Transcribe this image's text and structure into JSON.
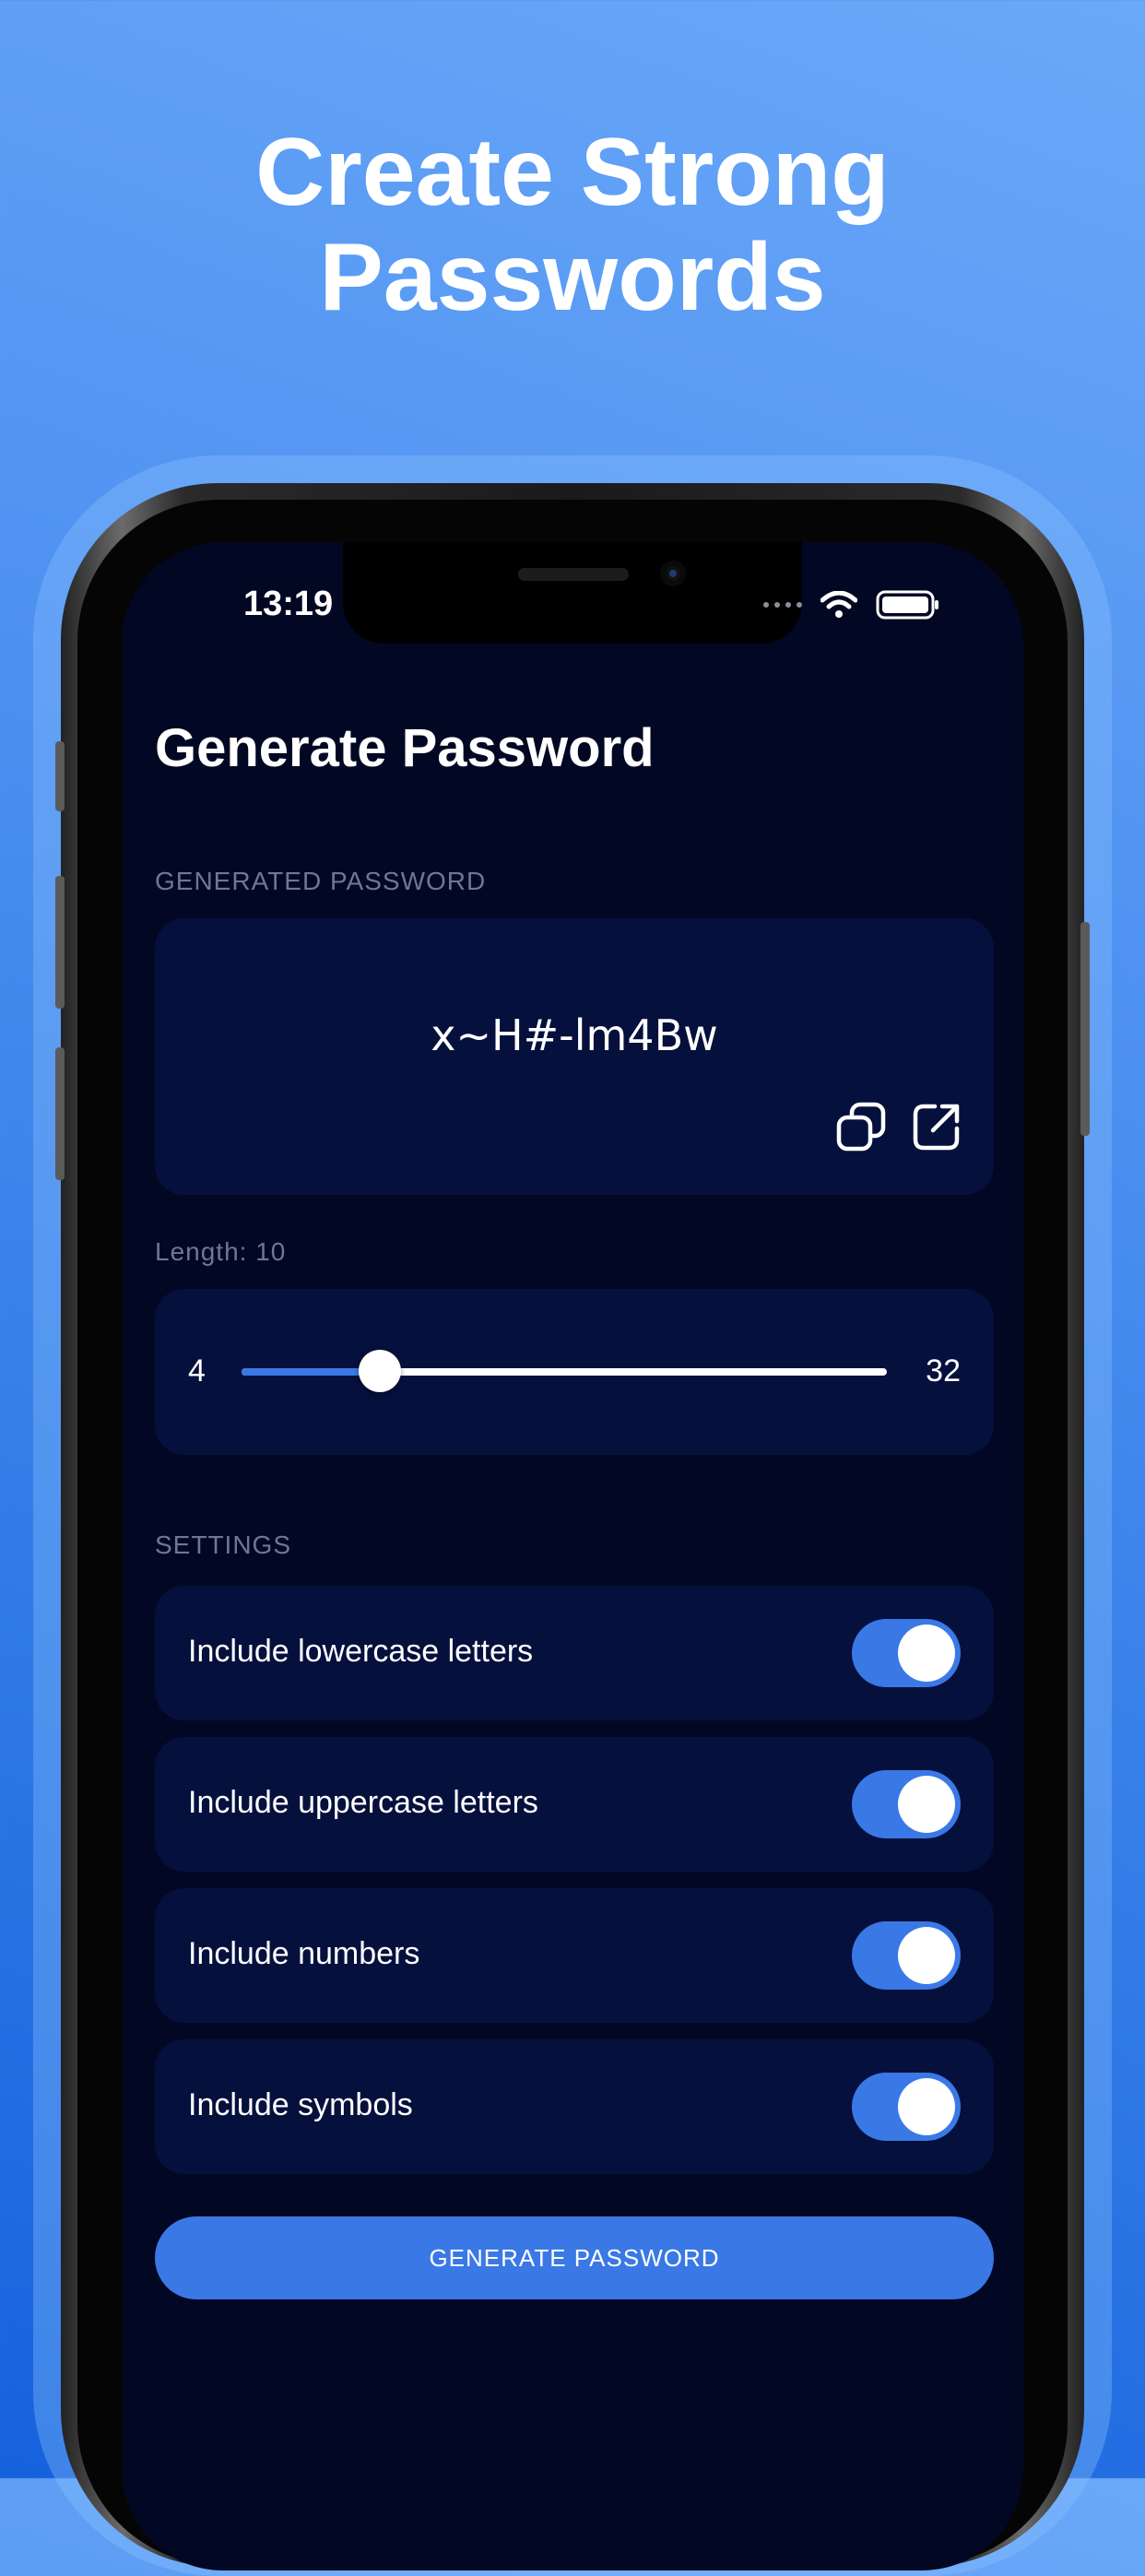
{
  "promo": {
    "headline_line1": "Create Strong",
    "headline_line2": "Passwords"
  },
  "status_bar": {
    "time": "13:19"
  },
  "screen": {
    "title": "Generate Password",
    "generated_label": "GENERATED PASSWORD",
    "password": "x~H#-lm4Bw",
    "length_label": "Length: 10",
    "length_value": 10,
    "slider": {
      "min_label": "4",
      "max_label": "32",
      "min": 4,
      "max": 32
    },
    "settings_label": "SETTINGS",
    "settings": [
      {
        "label": "Include lowercase letters",
        "enabled": true
      },
      {
        "label": "Include uppercase letters",
        "enabled": true
      },
      {
        "label": "Include numbers",
        "enabled": true
      },
      {
        "label": "Include symbols",
        "enabled": true
      }
    ],
    "generate_button": "GENERATE PASSWORD"
  },
  "icons": {
    "copy": "copy-icon",
    "share": "share-icon",
    "wifi": "wifi-icon",
    "battery": "battery-icon"
  },
  "colors": {
    "accent": "#3a78e6",
    "screen_bg": "#020823",
    "card_bg": "#06103d",
    "muted_label": "#6d7796"
  }
}
